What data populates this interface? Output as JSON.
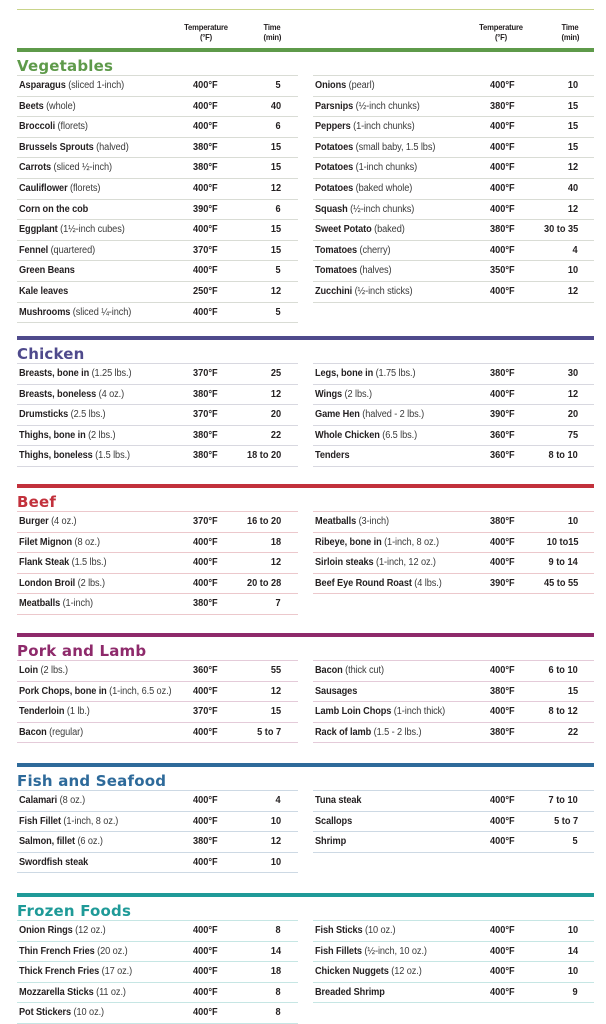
{
  "column_headers": {
    "temperature": "Temperature",
    "temperature_unit": "(°F)",
    "time": "Time",
    "time_unit": "(min)"
  },
  "sections": [
    {
      "title": "Vegetables",
      "color": "#5e9a4a",
      "rule": "#d9dcd5",
      "left": [
        {
          "name": "Asparagus",
          "note": "(sliced 1-inch)",
          "temp": "400°F",
          "time": "5"
        },
        {
          "name": "Beets",
          "note": "(whole)",
          "temp": "400°F",
          "time": "40"
        },
        {
          "name": "Broccoli",
          "note": "(florets)",
          "temp": "400°F",
          "time": "6"
        },
        {
          "name": "Brussels Sprouts",
          "note": "(halved)",
          "temp": "380°F",
          "time": "15"
        },
        {
          "name": "Carrots",
          "note": "(sliced ½-inch)",
          "temp": "380°F",
          "time": "15"
        },
        {
          "name": "Cauliflower",
          "note": "(florets)",
          "temp": "400°F",
          "time": "12"
        },
        {
          "name": "Corn on the cob",
          "note": "",
          "temp": "390°F",
          "time": "6"
        },
        {
          "name": "Eggplant",
          "note": "(1½-inch cubes)",
          "temp": "400°F",
          "time": "15"
        },
        {
          "name": "Fennel",
          "note": "(quartered)",
          "temp": "370°F",
          "time": "15"
        },
        {
          "name": "Green Beans",
          "note": "",
          "temp": "400°F",
          "time": "5"
        },
        {
          "name": "Kale leaves",
          "note": "",
          "temp": "250°F",
          "time": "12"
        },
        {
          "name": "Mushrooms",
          "note": "(sliced ¼-inch)",
          "temp": "400°F",
          "time": "5"
        }
      ],
      "right": [
        {
          "name": "Onions",
          "note": "(pearl)",
          "temp": "400°F",
          "time": "10"
        },
        {
          "name": "Parsnips",
          "note": "(½-inch chunks)",
          "temp": "380°F",
          "time": "15"
        },
        {
          "name": "Peppers",
          "note": "(1-inch chunks)",
          "temp": "400°F",
          "time": "15"
        },
        {
          "name": "Potatoes",
          "note": "(small baby, 1.5 lbs)",
          "temp": "400°F",
          "time": "15"
        },
        {
          "name": "Potatoes",
          "note": "(1-inch chunks)",
          "temp": "400°F",
          "time": "12"
        },
        {
          "name": "Potatoes",
          "note": "(baked whole)",
          "temp": "400°F",
          "time": "40"
        },
        {
          "name": "Squash",
          "note": "(½-inch chunks)",
          "temp": "400°F",
          "time": "12"
        },
        {
          "name": "Sweet Potato",
          "note": "(baked)",
          "temp": "380°F",
          "time": "30 to 35"
        },
        {
          "name": "Tomatoes",
          "note": "(cherry)",
          "temp": "400°F",
          "time": "4"
        },
        {
          "name": "Tomatoes",
          "note": "(halves)",
          "temp": "350°F",
          "time": "10"
        },
        {
          "name": "Zucchini",
          "note": "(½-inch sticks)",
          "temp": "400°F",
          "time": "12"
        }
      ]
    },
    {
      "title": "Chicken",
      "color": "#4f4a8c",
      "rule": "#d8d8e0",
      "left": [
        {
          "name": "Breasts, bone in",
          "note": "(1.25 lbs.)",
          "temp": "370°F",
          "time": "25"
        },
        {
          "name": "Breasts, boneless",
          "note": " (4 oz.)",
          "temp": "380°F",
          "time": "12"
        },
        {
          "name": "Drumsticks",
          "note": " (2.5 lbs.)",
          "temp": "370°F",
          "time": "20"
        },
        {
          "name": "Thighs, bone in",
          "note": " (2 lbs.)",
          "temp": "380°F",
          "time": "22"
        },
        {
          "name": "Thighs, boneless",
          "note": "(1.5 lbs.)",
          "temp": "380°F",
          "time": "18 to 20"
        }
      ],
      "right": [
        {
          "name": "Legs, bone in",
          "note": " (1.75 lbs.)",
          "temp": "380°F",
          "time": "30"
        },
        {
          "name": "Wings",
          "note": " (2 lbs.)",
          "temp": "400°F",
          "time": "12"
        },
        {
          "name": "Game Hen",
          "note": "(halved - 2 lbs.)",
          "temp": "390°F",
          "time": "20"
        },
        {
          "name": "Whole Chicken",
          "note": "(6.5 lbs.)",
          "temp": "360°F",
          "time": "75"
        },
        {
          "name": "Tenders",
          "note": "",
          "temp": "360°F",
          "time": "8 to 10"
        }
      ]
    },
    {
      "title": "Beef",
      "color": "#c2313c",
      "rule": "#ecc8cc",
      "left": [
        {
          "name": "Burger",
          "note": " (4 oz.)",
          "temp": "370°F",
          "time": "16 to 20"
        },
        {
          "name": "Filet Mignon",
          "note": "(8 oz.)",
          "temp": "400°F",
          "time": "18"
        },
        {
          "name": "Flank Steak",
          "note": " (1.5 lbs.)",
          "temp": "400°F",
          "time": "12"
        },
        {
          "name": "London Broil",
          "note": " (2 lbs.)",
          "temp": "400°F",
          "time": "20 to 28"
        },
        {
          "name": "Meatballs",
          "note": "(1-inch)",
          "temp": "380°F",
          "time": "7"
        }
      ],
      "right": [
        {
          "name": "Meatballs",
          "note": "(3-inch)",
          "temp": "380°F",
          "time": "10"
        },
        {
          "name": "Ribeye, bone in",
          "note": "(1-inch, 8 oz.)",
          "temp": "400°F",
          "time": "10 to15"
        },
        {
          "name": "Sirloin steaks",
          "note": "(1-inch, 12 oz.)",
          "temp": "400°F",
          "time": "9 to 14"
        },
        {
          "name": "Beef Eye Round Roast",
          "note": "(4 lbs.)",
          "temp": "390°F",
          "time": "45 to 55"
        }
      ]
    },
    {
      "title": "Pork and Lamb",
      "color": "#8e2a6b",
      "rule": "#e4cbd9",
      "left": [
        {
          "name": "Loin",
          "note": "(2 lbs.)",
          "temp": "360°F",
          "time": "55"
        },
        {
          "name": "Pork Chops, bone in",
          "note": "(1-inch, 6.5 oz.)",
          "temp": "400°F",
          "time": "12"
        },
        {
          "name": "Tenderloin",
          "note": "(1 lb.)",
          "temp": "370°F",
          "time": "15"
        },
        {
          "name": "Bacon",
          "note": "(regular)",
          "temp": "400°F",
          "time": "5 to 7"
        }
      ],
      "right": [
        {
          "name": "Bacon",
          "note": "(thick cut)",
          "temp": "400°F",
          "time": "6 to 10"
        },
        {
          "name": "Sausages",
          "note": "",
          "temp": "380°F",
          "time": "15"
        },
        {
          "name": "Lamb Loin Chops",
          "note": "(1-inch thick)",
          "temp": "400°F",
          "time": "8 to 12"
        },
        {
          "name": "Rack of lamb",
          "note": "(1.5 - 2 lbs.)",
          "temp": "380°F",
          "time": "22"
        }
      ]
    },
    {
      "title": "Fish and Seafood",
      "color": "#2e6a9a",
      "rule": "#cdd9e4",
      "left": [
        {
          "name": "Calamari",
          "note": "(8 oz.)",
          "temp": "400°F",
          "time": "4"
        },
        {
          "name": "Fish Fillet",
          "note": "(1-inch, 8 oz.)",
          "temp": "400°F",
          "time": "10"
        },
        {
          "name": "Salmon, fillet",
          "note": " (6 oz.)",
          "temp": "380°F",
          "time": "12"
        },
        {
          "name": "Swordfish steak",
          "note": "",
          "temp": "400°F",
          "time": "10"
        }
      ],
      "right": [
        {
          "name": "Tuna steak",
          "note": "",
          "temp": "400°F",
          "time": "7 to 10"
        },
        {
          "name": "Scallops",
          "note": "",
          "temp": "400°F",
          "time": "5 to 7"
        },
        {
          "name": "Shrimp",
          "note": "",
          "temp": "400°F",
          "time": "5"
        }
      ]
    },
    {
      "title": "Frozen Foods",
      "color": "#1f9a98",
      "rule": "#c6e6e4",
      "left": [
        {
          "name": "Onion Rings",
          "note": " (12 oz.)",
          "temp": "400°F",
          "time": "8"
        },
        {
          "name": "Thin French Fries",
          "note": " (20 oz.)",
          "temp": "400°F",
          "time": "14"
        },
        {
          "name": "Thick French Fries",
          "note": "(17 oz.)",
          "temp": "400°F",
          "time": "18"
        },
        {
          "name": "Mozzarella Sticks",
          "note": "(11 oz.)",
          "temp": "400°F",
          "time": "8"
        },
        {
          "name": "Pot Stickers",
          "note": "(10 oz.)",
          "temp": "400°F",
          "time": "8"
        }
      ],
      "right": [
        {
          "name": "Fish Sticks",
          "note": "(10 oz.)",
          "temp": "400°F",
          "time": "10"
        },
        {
          "name": "Fish Fillets",
          "note": "(½-inch, 10 oz.)",
          "temp": "400°F",
          "time": "14"
        },
        {
          "name": "Chicken Nuggets",
          "note": " (12 oz.)",
          "temp": "400°F",
          "time": "10"
        },
        {
          "name": "Breaded Shrimp",
          "note": "",
          "temp": "400°F",
          "time": "9"
        }
      ]
    }
  ]
}
